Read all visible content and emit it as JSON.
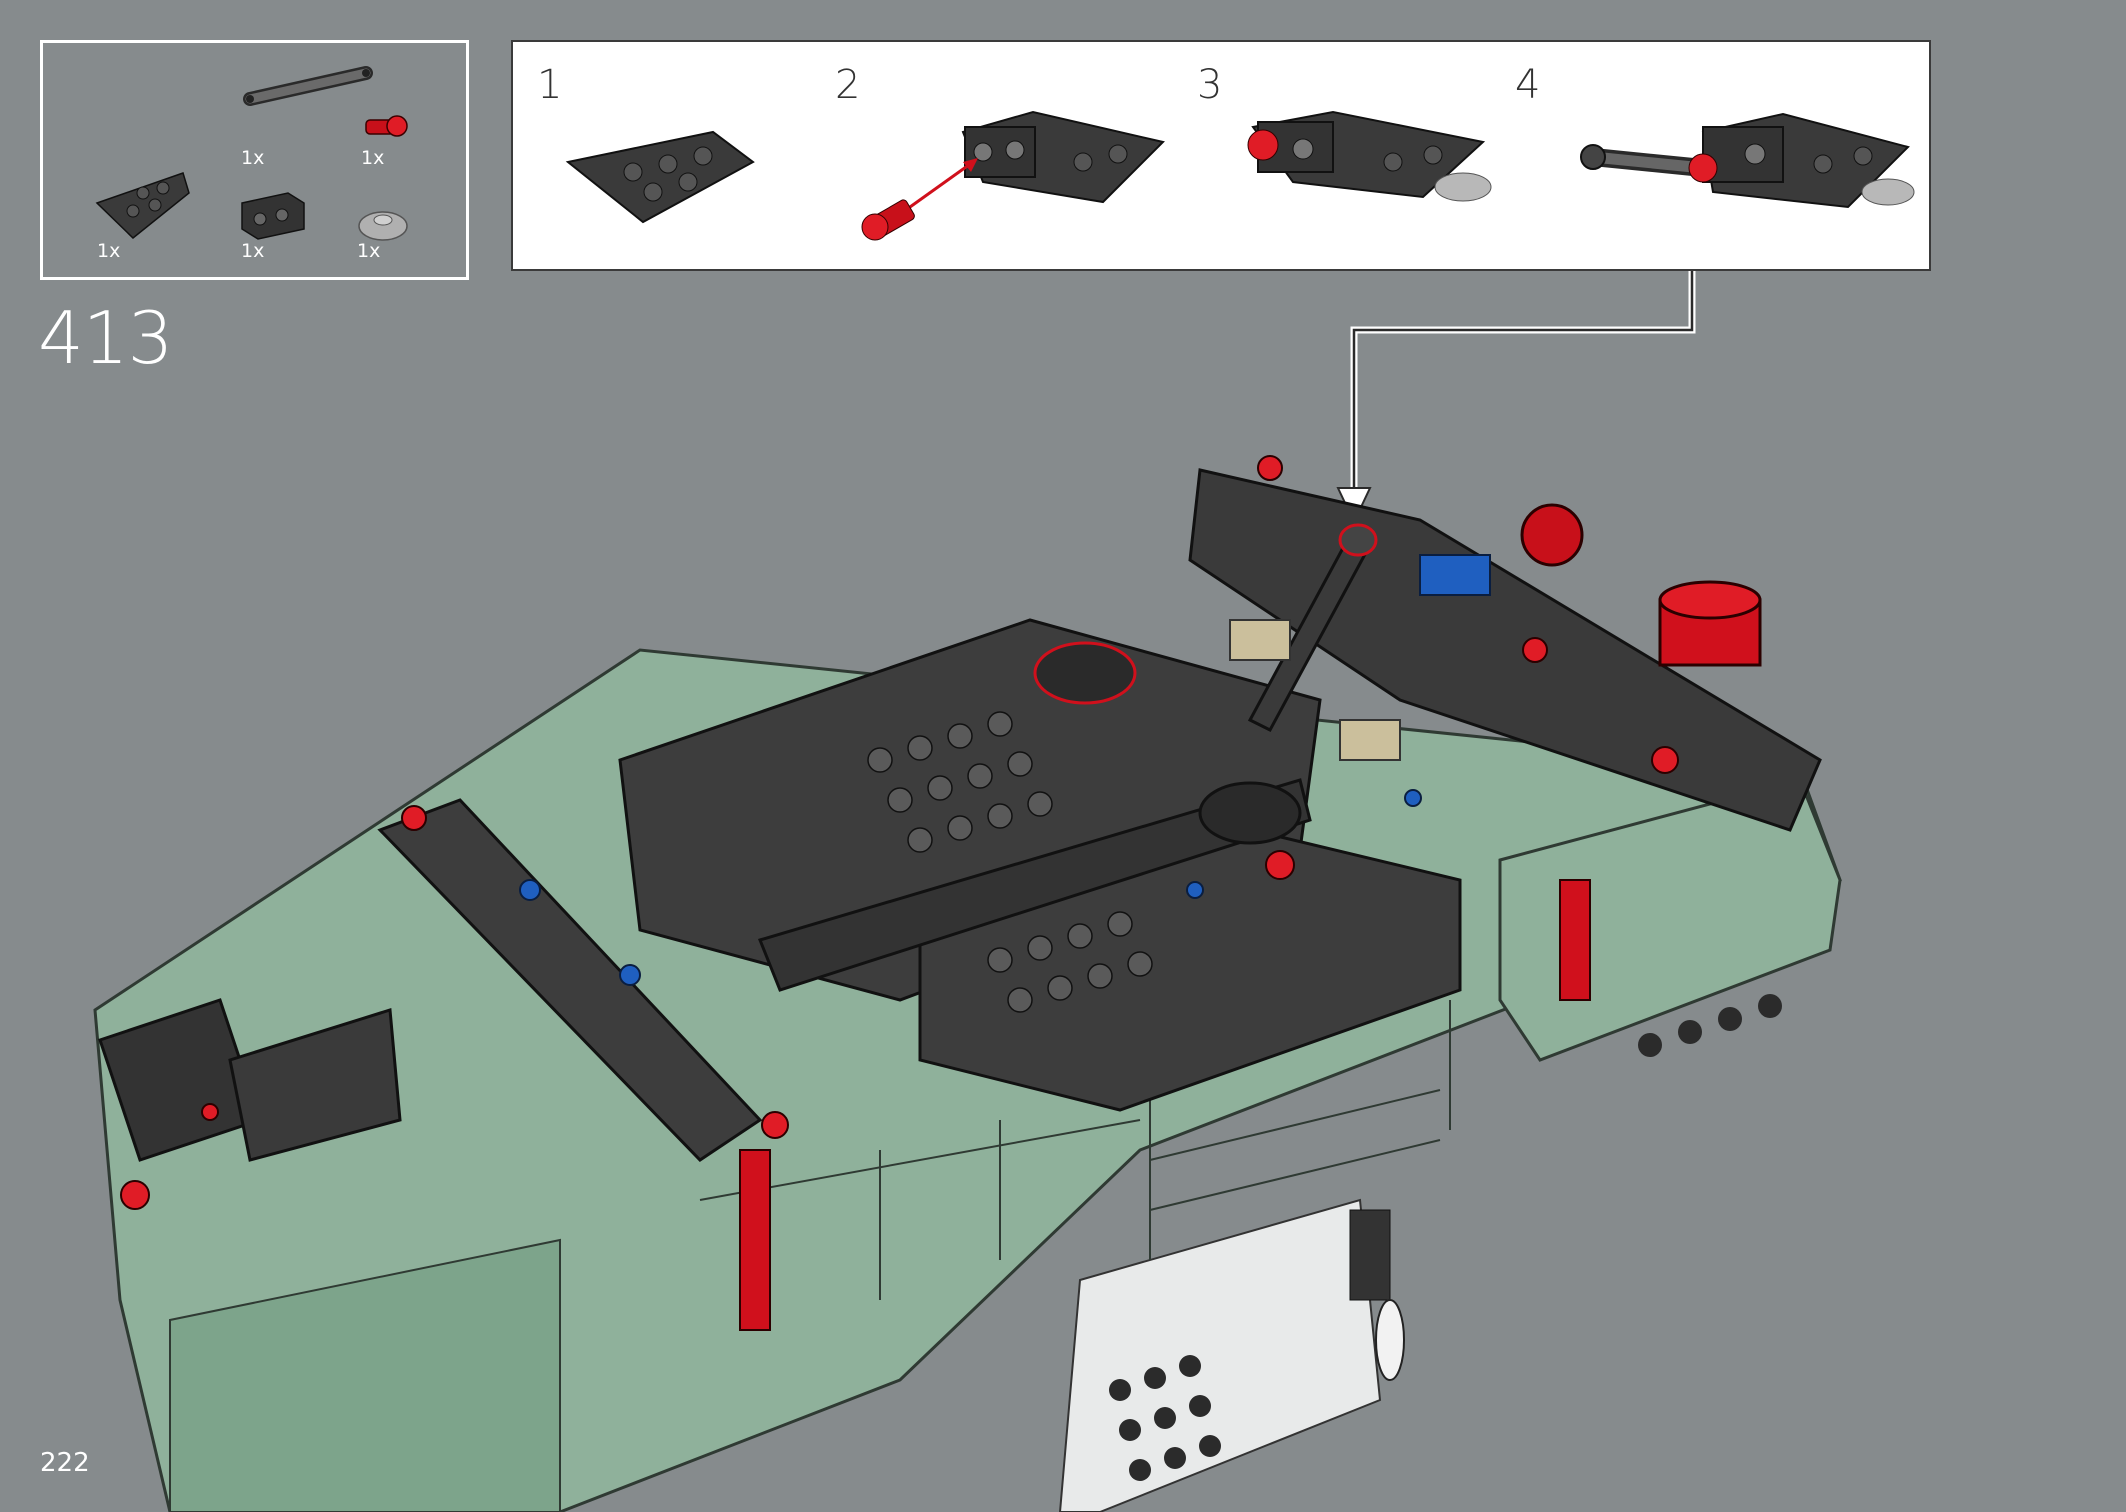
{
  "step": {
    "number": "413"
  },
  "page": {
    "number": "222"
  },
  "parts": [
    {
      "name": "wedge-plate-dark-gray",
      "qty": "1x"
    },
    {
      "name": "technic-link-dark-gray",
      "qty": "1x"
    },
    {
      "name": "pin-red",
      "qty": "1x"
    },
    {
      "name": "brick-with-holes-dark-gray",
      "qty": "1x"
    },
    {
      "name": "round-plate-light-gray",
      "qty": "1x"
    }
  ],
  "substeps": [
    {
      "label": "1"
    },
    {
      "label": "2"
    },
    {
      "label": "3"
    },
    {
      "label": "4"
    }
  ],
  "colors": {
    "background": "#868b8d",
    "body_green": "#8fb19b",
    "dark_gray": "#3d3d3d",
    "red": "#d0101c",
    "blue": "#1f5fc0",
    "tan": "#cbbf9c"
  }
}
